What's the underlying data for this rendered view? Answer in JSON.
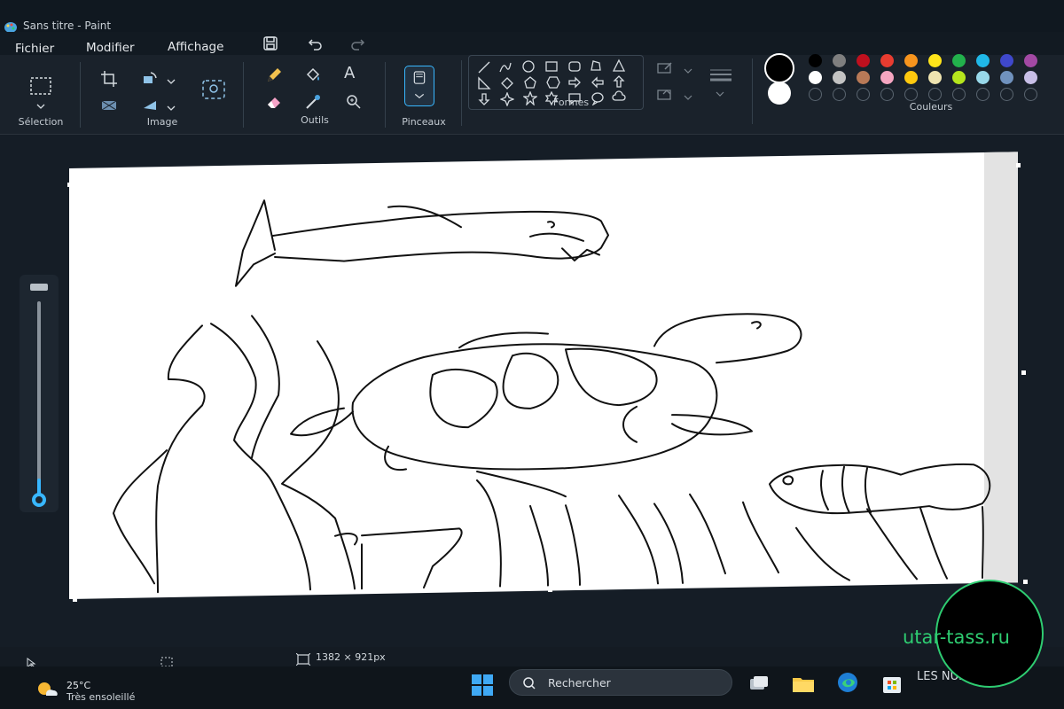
{
  "window": {
    "title": "Sans titre - Paint"
  },
  "menu": {
    "file": "Fichier",
    "edit": "Modifier",
    "view": "Affichage"
  },
  "quick_access": [
    "save-icon",
    "undo-icon",
    "redo-icon"
  ],
  "ribbon": {
    "groups": {
      "selection": "Sélection",
      "image": "Image",
      "tools": "Outils",
      "brushes": "Pinceaux",
      "shapes": "Formes",
      "colors": "Couleurs"
    },
    "tool_icons": [
      "pencil-icon",
      "fill-icon",
      "text-icon",
      "eraser-icon",
      "color-picker-icon",
      "magnifier-icon"
    ],
    "text_tool_glyph": "A"
  },
  "colors": {
    "primary": "#000000",
    "secondary": "#ffffff",
    "palette_row1": [
      "#000000",
      "#7f7f7f",
      "#c0101e",
      "#e83c30",
      "#f7941d",
      "#ffe41a",
      "#22b14c",
      "#20b8e8",
      "#3f48cc",
      "#a349a4"
    ],
    "palette_row2": [
      "#ffffff",
      "#c3c3c3",
      "#b97a57",
      "#f6a6c1",
      "#ffc90e",
      "#efe4b0",
      "#b5e61d",
      "#99d9ea",
      "#7092be",
      "#c8bfe7"
    ]
  },
  "status": {
    "canvas_size": "1382 × 921px"
  },
  "taskbar": {
    "weather_temp": "25°C",
    "weather_desc": "Très ensoleillé",
    "search_placeholder": "Rechercher",
    "tray_partial": "LES NUI"
  },
  "watermark": {
    "text": "utar-tass.ru",
    "accent": "#2ecc71"
  }
}
